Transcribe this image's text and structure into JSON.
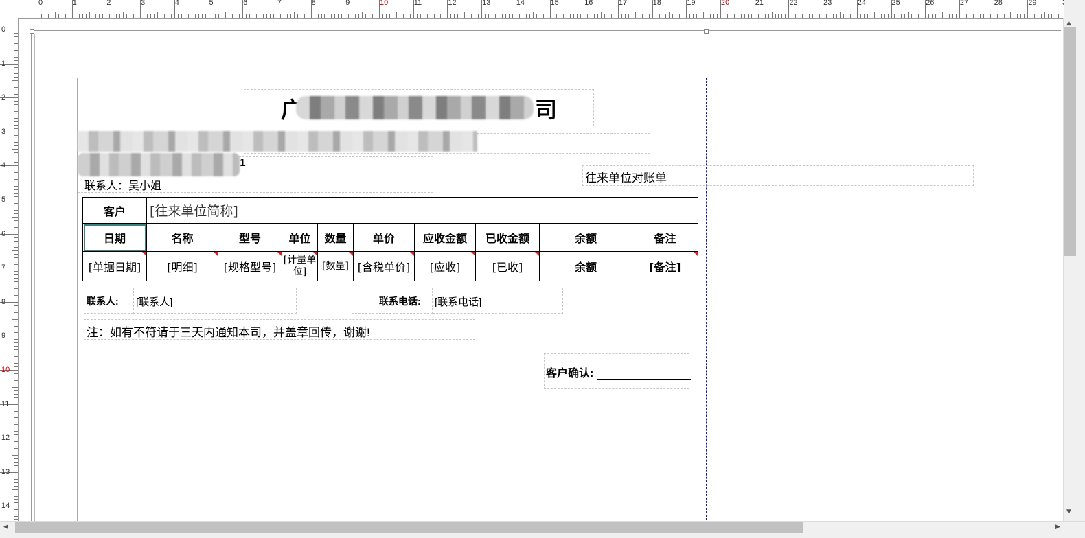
{
  "rulers": {
    "horizontal": [
      "0",
      "1",
      "2",
      "3",
      "4",
      "5",
      "6",
      "7",
      "8",
      "9",
      "10",
      "11",
      "12",
      "13",
      "14",
      "15",
      "16",
      "17",
      "18",
      "19",
      "20",
      "21",
      "22",
      "23",
      "24",
      "25",
      "26",
      "27",
      "28",
      "29",
      "3"
    ],
    "vertical": [
      "0",
      "1",
      "2",
      "3",
      "4",
      "5",
      "6",
      "7",
      "8",
      "9",
      "10",
      "11",
      "12",
      "13",
      "14"
    ],
    "highlight": [
      "10",
      "20"
    ]
  },
  "report": {
    "company_prefix": "广",
    "company_suffix": "司",
    "address_tail": "1",
    "contact_line": "联系人：吴小姐",
    "report_title": "往来单位对账单",
    "customer_label": "客户",
    "customer_field": "[往来单位简称]",
    "headers": [
      "日期",
      "名称",
      "型号",
      "单位",
      "数量",
      "单价",
      "应收金额",
      "已收金额",
      "余额",
      "备注"
    ],
    "fields": [
      "[单据日期]",
      "[明细]",
      "[规格型号]",
      "[计量单位]",
      "[数量]",
      "[含税单价]",
      "[应收]",
      "[已收]",
      "余额",
      "[备注]"
    ],
    "footer_contact_label": "联系人:",
    "footer_contact_field": "[联系人]",
    "footer_phone_label": "联系电话:",
    "footer_phone_field": "[联系电话]",
    "note": "注：如有不符请于三天内通知本司，并盖章回传，谢谢!",
    "confirm_label": "客户确认:"
  },
  "colors": {
    "ruler_highlight": "#d00000",
    "page_margin_line": "#1a1aa8",
    "field_marker": "#e02020"
  },
  "icons": {
    "scroll_up": "▲",
    "scroll_down": "▼",
    "scroll_left": "◀",
    "scroll_right": "▶"
  }
}
